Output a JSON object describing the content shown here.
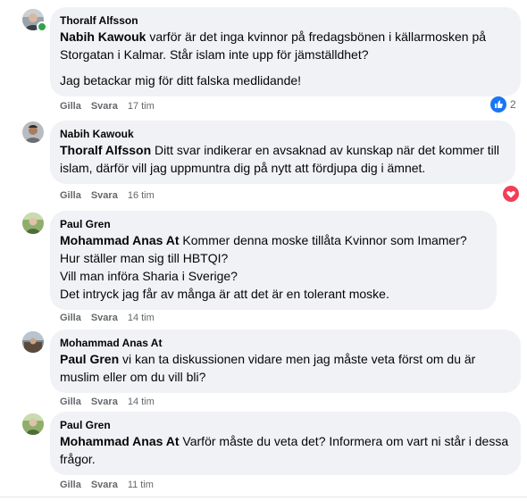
{
  "comments": [
    {
      "author": "Thoralf Alfsson",
      "online": true,
      "paragraphs": [
        {
          "mention": "Nabih Kawouk",
          "text": " varför är det inga kvinnor på fredagsbönen i källarmosken på Storgatan i Kalmar. Står islam inte upp för jämställdhet?"
        },
        {
          "mention": "",
          "text": "Jag betackar mig för ditt falska medlidande!"
        }
      ],
      "like": "Gilla",
      "reply": "Svara",
      "time": "17 tim",
      "reaction": {
        "icon": "like-icon",
        "count": "2",
        "color": "#1877f2"
      }
    },
    {
      "author": "Nabih Kawouk",
      "online": false,
      "paragraphs": [
        {
          "mention": "Thoralf Alfsson",
          "text": " Ditt svar indikerar en avsaknad av kunskap när det kommer till islam, därför vill jag uppmuntra dig på nytt att fördjupa dig i ämnet."
        }
      ],
      "like": "Gilla",
      "reply": "Svara",
      "time": "16 tim",
      "reaction": {
        "icon": "heart-icon",
        "count": "",
        "color": "#f33e58"
      }
    },
    {
      "author": "Paul Gren",
      "online": false,
      "paragraphs": [
        {
          "mention": "Mohammad Anas At",
          "text": " Kommer denna moske tillåta Kvinnor som Imamer?"
        },
        {
          "mention": "",
          "text": "Hur ställer man sig till HBTQI?"
        },
        {
          "mention": "",
          "text": "Vill man införa Sharia i Sverige?"
        },
        {
          "mention": "",
          "text": "Det intryck jag får av många är att det är en tolerant moske."
        }
      ],
      "like": "Gilla",
      "reply": "Svara",
      "time": "14 tim"
    },
    {
      "author": "Mohammad Anas At",
      "online": false,
      "paragraphs": [
        {
          "mention": "Paul Gren",
          "text": " vi kan ta diskussionen vidare men jag måste veta först om du är muslim eller om du vill bli?"
        }
      ],
      "like": "Gilla",
      "reply": "Svara",
      "time": "14 tim"
    },
    {
      "author": "Paul Gren",
      "online": false,
      "paragraphs": [
        {
          "mention": "Mohammad Anas At",
          "text": " Varför måste du veta det? Informera om vart ni står i dessa frågor."
        }
      ],
      "like": "Gilla",
      "reply": "Svara",
      "time": "11 tim"
    }
  ]
}
